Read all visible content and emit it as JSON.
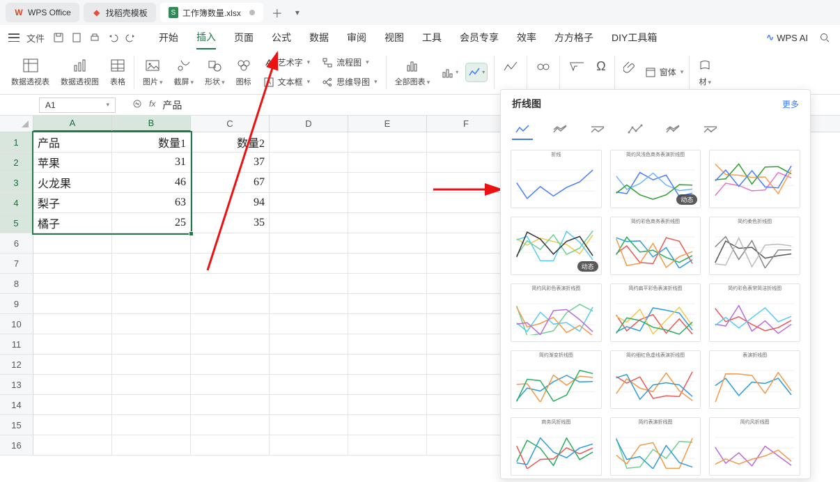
{
  "tabs": {
    "t0_label": "WPS Office",
    "t1_label": "找稻壳模板",
    "t2_label": "工作簿数量.xlsx"
  },
  "menubar": {
    "file": "文件",
    "items": [
      "开始",
      "插入",
      "页面",
      "公式",
      "数据",
      "审阅",
      "视图",
      "工具",
      "会员专享",
      "效率",
      "方方格子",
      "DIY工具箱"
    ],
    "active_index": 1,
    "ai_label": "WPS AI"
  },
  "ribbon": {
    "pivot_table": "数据透视表",
    "pivot_chart": "数据透视图",
    "table": "表格",
    "picture": "图片",
    "screenshot": "截屏",
    "shape": "形状",
    "icon": "图标",
    "wordart": "艺术字",
    "flowchart": "流程图",
    "textbox": "文本框",
    "mindmap": "思维导图",
    "all_charts": "全部图表",
    "window": "窗体",
    "more_cut": "材"
  },
  "namebox": "A1",
  "formula_value": "产品",
  "columns": [
    "A",
    "B",
    "C",
    "D",
    "E",
    "F"
  ],
  "rows": [
    "1",
    "2",
    "3",
    "4",
    "5",
    "6",
    "7",
    "8",
    "9",
    "10",
    "11",
    "12",
    "13",
    "14",
    "15",
    "16"
  ],
  "selected_rows": 5,
  "cells": {
    "A1": "产品",
    "B1": "数量1",
    "C1": "数量2",
    "A2": "苹果",
    "B2": "31",
    "C2": "37",
    "A3": "火龙果",
    "B3": "46",
    "C3": "67",
    "A4": "梨子",
    "B4": "63",
    "C4": "94",
    "A5": "橘子",
    "B5": "25",
    "C5": "35"
  },
  "chartpanel": {
    "title": "折线图",
    "more": "更多",
    "badge_dynamic": "动态",
    "thumbs": [
      "折线",
      "简约风浅色商务表演折线图",
      "",
      "",
      "简约彩色商务表折线图",
      "简约柔色折线图",
      "简约风彩色表演折线图",
      "简约扁平彩色表演折线图",
      "简约彩色表常简洁折线图",
      "简约渐变折线图",
      "简约细红色虚线表演折线图",
      "表演折线图",
      "商务风折线图",
      "简约表演折线图",
      "简约风折线图"
    ]
  },
  "chart_data": {
    "type": "table",
    "title": "工作簿数量",
    "columns": [
      "产品",
      "数量1",
      "数量2"
    ],
    "rows": [
      [
        "苹果",
        31,
        37
      ],
      [
        "火龙果",
        46,
        67
      ],
      [
        "梨子",
        63,
        94
      ],
      [
        "橘子",
        25,
        35
      ]
    ]
  }
}
